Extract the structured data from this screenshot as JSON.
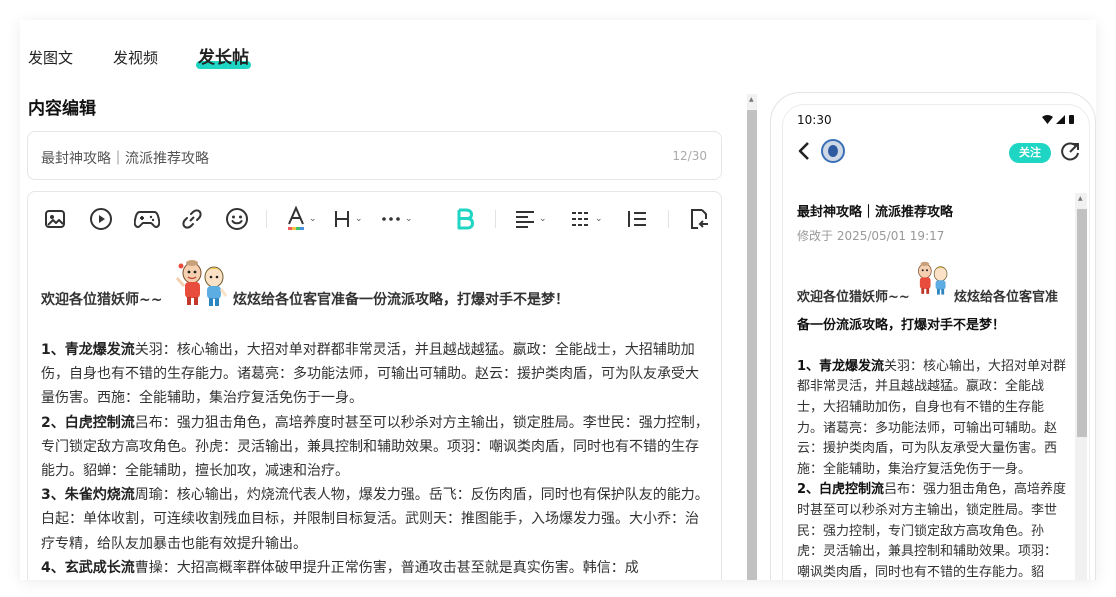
{
  "tabs": [
    {
      "label": "发图文"
    },
    {
      "label": "发视频"
    },
    {
      "label": "发长帖"
    }
  ],
  "section_title": "内容编辑",
  "title_input": {
    "value": "最封神攻略｜流派推荐攻略",
    "count": "12/30"
  },
  "toolbar_icons": [
    "image-icon",
    "video-icon",
    "gamepad-icon",
    "link-icon",
    "emoji-icon",
    "font-color-icon",
    "heading-icon",
    "more-icon",
    "bold-icon",
    "align-icon",
    "line-spacing-icon",
    "indent-icon",
    "undo-icon"
  ],
  "editor": {
    "welcome_left": "欢迎各位猎妖师~~",
    "welcome_right": "炫炫给各位客官准备一份流派攻略，打爆对手不是梦！",
    "p1_head": "1、青龙爆发流",
    "p1_body": "关羽：核心输出，大招对单对群都非常灵活，并且越战越猛。嬴政：全能战士，大招辅助加伤，自身也有不错的生存能力。诸葛亮：多功能法师，可输出可辅助。赵云：援护类肉盾，可为队友承受大量伤害。西施：全能辅助，集治疗复活免伤于一身。",
    "p2_head": "2、白虎控制流",
    "p2_body": "吕布：强力狙击角色，高培养度时甚至可以秒杀对方主输出，锁定胜局。李世民：强力控制，专门锁定敌方高攻角色。孙虎：灵活输出，兼具控制和辅助效果。项羽：嘲讽类肉盾，同时也有不错的生存能力。貂蝉：全能辅助，擅长加攻，减速和治疗。",
    "p3_head": "3、朱雀灼烧流",
    "p3_body": "周瑜：核心输出，灼烧流代表人物，爆发力强。岳飞：反伤肉盾，同时也有保护队友的能力。白起：单体收割，可连续收割残血目标，并限制目标复活。武则天：推图能手，入场爆发力强。大小乔：治疗专精，给队友加暴击也能有效提升输出。",
    "p4_head": "4、玄武成长流",
    "p4_body": "曹操：大招高概率群体破甲提升正常伤害，普通攻击甚至就是真实伤害。韩信：成"
  },
  "preview": {
    "time": "10:30",
    "follow_label": "关注",
    "title": "最封神攻略｜流派推荐攻略",
    "date": "修改于 2025/05/01 19:17",
    "welcome_left": "欢迎各位猎妖师~~",
    "welcome_right": "炫炫给各位客官准",
    "welcome_line2": "备一份流派攻略，打爆对手不是梦！",
    "p1_head": "1、青龙爆发流",
    "p1_body": "关羽：核心输出，大招对单对群都非常灵活，并且越战越猛。嬴政：全能战士，大招辅助加伤，自身也有不错的生存能力。诸葛亮：多功能法师，可输出可辅助。赵云：援护类肉盾，可为队友承受大量伤害。西施：全能辅助，集治疗复活免伤于一身。",
    "p2_head": "2、白虎控制流",
    "p2_body": "吕布：强力狙击角色，高培养度时甚至可以秒杀对方主输出，锁定胜局。李世民：强力控制，专门锁定敌方高攻角色。孙虎：灵活输出，兼具控制和辅助效果。项羽：嘲讽类肉盾，同时也有不错的生存能力。貂蝉：全能辅助，擅长加攻，减速和治疗。"
  },
  "colors": {
    "accent": "#1fd5c4"
  }
}
